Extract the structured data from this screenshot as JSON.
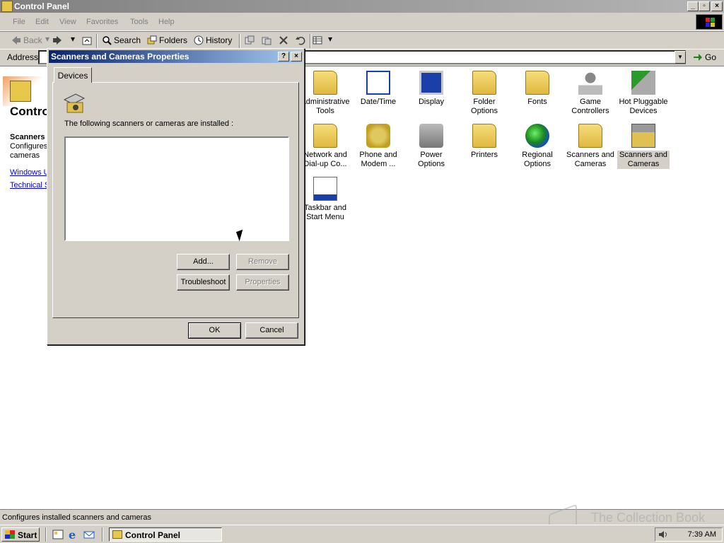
{
  "window": {
    "title": "Control Panel",
    "minimize": "_",
    "restore": "▫",
    "close": "×"
  },
  "menubar": [
    "File",
    "Edit",
    "View",
    "Favorites",
    "Tools",
    "Help"
  ],
  "toolbar": {
    "back": "Back",
    "search": "Search",
    "folders": "Folders",
    "history": "History"
  },
  "address": {
    "label": "Address",
    "go": "Go"
  },
  "left_panel": {
    "title": "Contro",
    "heading": "Scanners",
    "desc_line1": "Configures",
    "desc_line2": "cameras",
    "link1": "Windows U",
    "link2": "Technical S"
  },
  "items": [
    {
      "label": "Administrative Tools",
      "icon": "folder-tools-icon"
    },
    {
      "label": "Date/Time",
      "icon": "calendar-clock-icon"
    },
    {
      "label": "Display",
      "icon": "monitor-icon"
    },
    {
      "label": "Folder Options",
      "icon": "folder-options-icon"
    },
    {
      "label": "Fonts",
      "icon": "fonts-folder-icon"
    },
    {
      "label": "Game Controllers",
      "icon": "joystick-icon"
    },
    {
      "label": "Hot Pluggable Devices",
      "icon": "plug-icon"
    },
    {
      "label": "Network and Dial-up Co...",
      "icon": "network-folder-icon"
    },
    {
      "label": "Phone and Modem ...",
      "icon": "phone-icon"
    },
    {
      "label": "Power Options",
      "icon": "power-plug-icon"
    },
    {
      "label": "Printers",
      "icon": "printer-folder-icon"
    },
    {
      "label": "Regional Options",
      "icon": "globe-icon"
    },
    {
      "label": "Scanners and Cameras",
      "icon": "scanner-folder-icon"
    },
    {
      "label": "Scanners and Cameras",
      "icon": "scanner-icon"
    },
    {
      "label": "Taskbar and Start Menu",
      "icon": "taskbar-icon"
    }
  ],
  "dialog": {
    "title": "Scanners and Cameras Properties",
    "help": "?",
    "close": "×",
    "tab": "Devices",
    "description": "The following scanners or cameras are installed :",
    "buttons": {
      "add": "Add...",
      "remove": "Remove",
      "troubleshoot": "Troubleshoot",
      "properties": "Properties",
      "ok": "OK",
      "cancel": "Cancel"
    }
  },
  "statusbar": {
    "text": "Configures installed scanners and cameras"
  },
  "taskbar": {
    "start": "Start",
    "task": "Control Panel",
    "clock": "7:39 AM",
    "watermark": "The Collection Book"
  }
}
